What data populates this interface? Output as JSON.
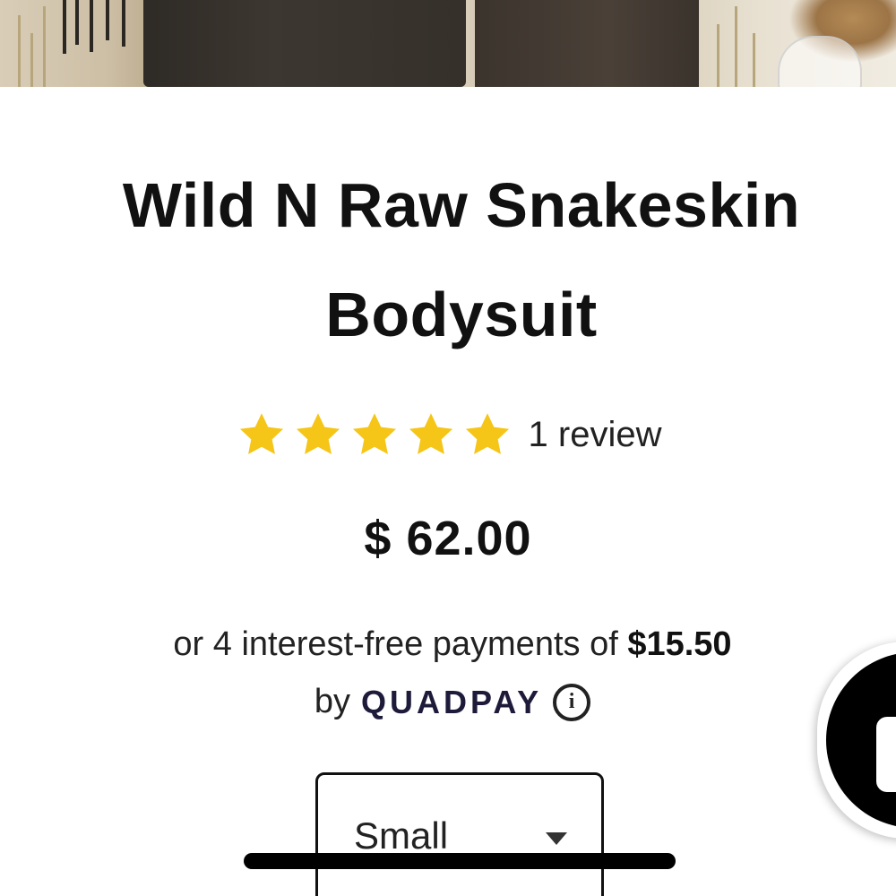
{
  "product": {
    "title_line1": "Wild N Raw Snakeskin",
    "title_line2": "Bodysuit",
    "rating": {
      "stars": 5,
      "max_stars": 5,
      "review_count_label": "1 review",
      "star_color": "#F5C518"
    },
    "price": "$ 62.00"
  },
  "installments": {
    "prefix": "or 4 interest-free payments of",
    "amount": "$15.50",
    "by_label": "by",
    "provider": "QUADPAY",
    "info_symbol": "i"
  },
  "size_select": {
    "selected": "Small"
  },
  "chat_widget": {
    "icon": "close-icon"
  }
}
